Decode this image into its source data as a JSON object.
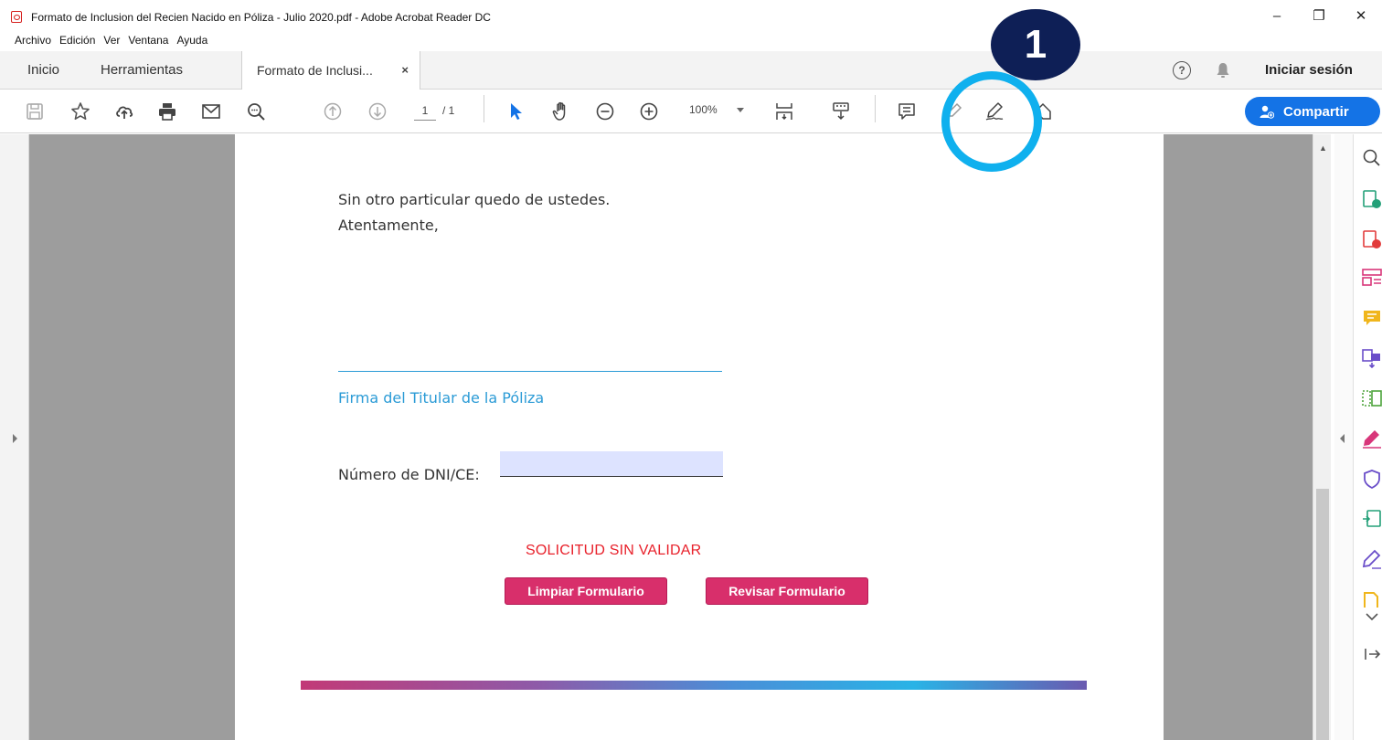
{
  "window": {
    "title": "Formato de Inclusion del Recien Nacido en Póliza - Julio 2020.pdf - Adobe Acrobat Reader DC",
    "minimize": "–",
    "restore": "❐",
    "close": "✕"
  },
  "menu": [
    "Archivo",
    "Edición",
    "Ver",
    "Ventana",
    "Ayuda"
  ],
  "tabs": {
    "home": "Inicio",
    "tools": "Herramientas",
    "document": "Formato de Inclusi...",
    "close_glyph": "×",
    "help_glyph": "?",
    "sign_in": "Iniciar sesión"
  },
  "toolbar": {
    "page_current": "1",
    "page_total": "/ 1",
    "zoom": "100%",
    "share_label": "Compartir"
  },
  "document": {
    "closing_line": "Sin otro particular quedo de ustedes.",
    "salutation": "Atentamente,",
    "signature_caption": "Firma del Titular de la Póliza",
    "dni_label": "Número de DNI/CE:",
    "dni_value": "",
    "status": "SOLICITUD SIN VALIDAR",
    "clear_button": "Limpiar Formulario",
    "review_button": "Revisar Formulario"
  },
  "annotation": {
    "badge_number": "1"
  },
  "colors": {
    "accent_blue": "#1473e6",
    "form_button": "#d82f6b",
    "status_red": "#e8202a",
    "callout_ring": "#0fb0ee",
    "callout_badge": "#0e1f56",
    "signature_line": "#2b9bd6"
  }
}
